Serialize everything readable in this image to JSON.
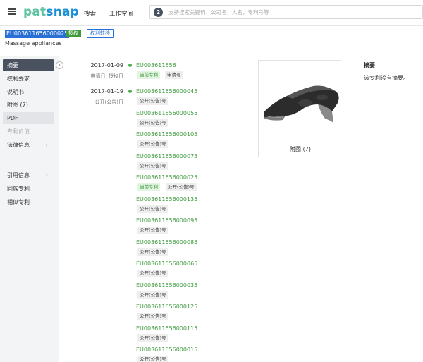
{
  "header": {
    "logo_pat": "pat",
    "logo_snap": "snap",
    "nav": [
      "搜索",
      "工作空间"
    ],
    "search_badge": "2",
    "search_placeholder": "支持搜索关键词，公司名，人名，专利号等"
  },
  "patent": {
    "id": "EU003611656000025",
    "tag_grant": "授权",
    "tag_transfer": "权利转移",
    "title": "Massage appliances"
  },
  "sidebar": {
    "items": [
      {
        "label": "摘要",
        "state": "active"
      },
      {
        "label": "权利要求",
        "state": "normal"
      },
      {
        "label": "说明书",
        "state": "normal"
      },
      {
        "label": "附图 (7)",
        "state": "normal"
      },
      {
        "label": "PDF",
        "state": "highlight"
      },
      {
        "label": "专利价值",
        "state": "disabled"
      },
      {
        "label": "法律信息",
        "state": "normal",
        "chevron": "›"
      },
      {
        "label": "引用信息",
        "state": "normal",
        "chevron": "›"
      },
      {
        "label": "同族专利",
        "state": "normal"
      },
      {
        "label": "相似专利",
        "state": "normal"
      }
    ],
    "collapse_glyph": "‹"
  },
  "timeline": {
    "date1": "2017-01-09",
    "date1_sub": "申请日, 授权日",
    "date2": "2017-01-19",
    "date2_sub": "公开(公告)日",
    "app_number": "EU003611656",
    "tag_current": "当前专利",
    "tag_app": "申请号",
    "tag_pub": "公开(公告)号",
    "pubs": [
      "EU003611656000045",
      "EU003611656000055",
      "EU003611656000105",
      "EU003611656000075",
      "EU003611656000025",
      "EU003611656000135",
      "EU003611656000095",
      "EU003611656000085",
      "EU003611656000065",
      "EU003611656000035",
      "EU003611656000125",
      "EU003611656000115",
      "EU003611656000015"
    ],
    "current_index": 4
  },
  "drawing": {
    "caption": "附图 (7)"
  },
  "abstract": {
    "title": "摘要",
    "text": "该专利没有摘要。"
  },
  "colors": {
    "accent_blue": "#2a6fd6",
    "green": "#4caf50",
    "sidebar_active": "#4a5260"
  }
}
